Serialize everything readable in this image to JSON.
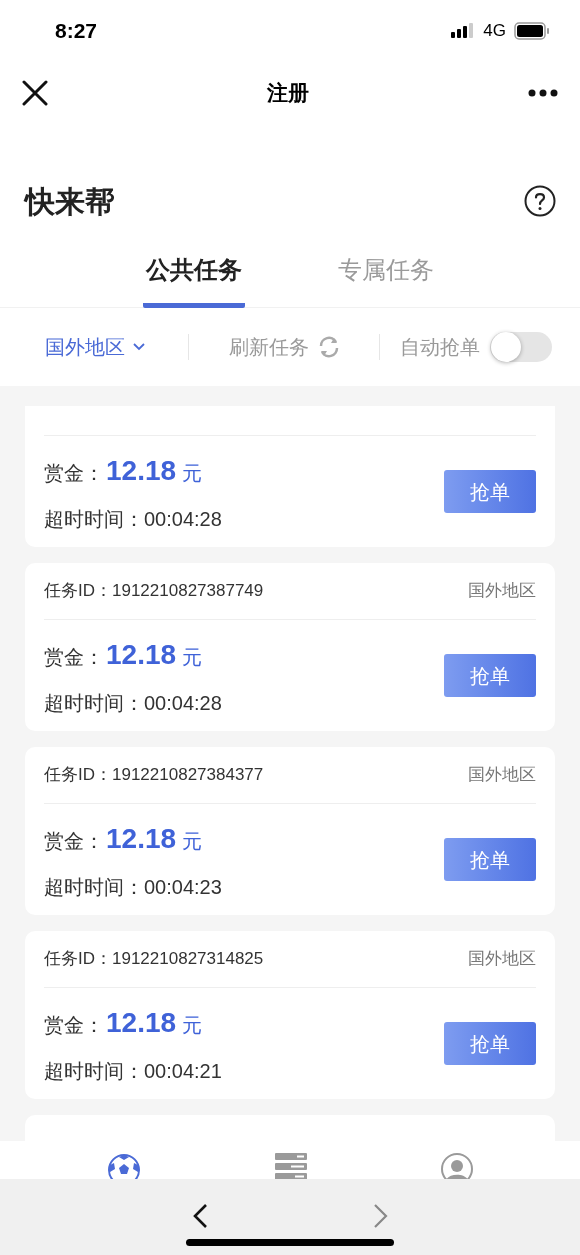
{
  "status_bar": {
    "time": "8:27",
    "network": "4G"
  },
  "nav": {
    "title": "注册"
  },
  "header": {
    "title": "快来帮"
  },
  "tabs": [
    {
      "label": "公共任务",
      "selected": true
    },
    {
      "label": "专属任务",
      "selected": false
    }
  ],
  "filters": {
    "region": "国外地区",
    "refresh": "刷新任务",
    "auto_grab": {
      "label": "自动抢单",
      "on": false
    }
  },
  "tasks": [
    {
      "reward_label": "赏金：",
      "reward": "12.18",
      "unit": "元",
      "timeout_label": "超时时间：",
      "timeout": "00:04:28",
      "button": "抢单"
    },
    {
      "id_label": "任务ID：",
      "id": "1912210827387749",
      "region": "国外地区",
      "reward_label": "赏金：",
      "reward": "12.18",
      "unit": "元",
      "timeout_label": "超时时间：",
      "timeout": "00:04:28",
      "button": "抢单"
    },
    {
      "id_label": "任务ID：",
      "id": "1912210827384377",
      "region": "国外地区",
      "reward_label": "赏金：",
      "reward": "12.18",
      "unit": "元",
      "timeout_label": "超时时间：",
      "timeout": "00:04:23",
      "button": "抢单"
    },
    {
      "id_label": "任务ID：",
      "id": "1912210827314825",
      "region": "国外地区",
      "reward_label": "赏金：",
      "reward": "12.18",
      "unit": "元",
      "timeout_label": "超时时间：",
      "timeout": "00:04:21",
      "button": "抢单"
    }
  ],
  "more_below": true,
  "bottom_tabs": [
    {
      "kind": "ball",
      "selected": true
    },
    {
      "kind": "list",
      "selected": false
    },
    {
      "kind": "profile",
      "selected": false
    }
  ]
}
